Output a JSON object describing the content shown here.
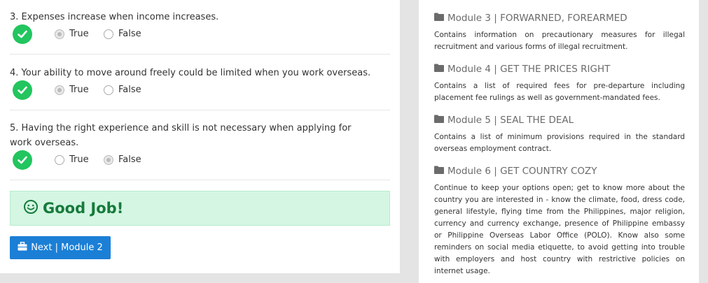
{
  "quiz": {
    "questions": [
      {
        "text": "3. Expenses increase when income increases.",
        "true_label": "True",
        "false_label": "False",
        "selected": "True"
      },
      {
        "text": "4. Your ability to move around freely could be limited when you work overseas.",
        "true_label": "True",
        "false_label": "False",
        "selected": "True"
      },
      {
        "text": "5. Having the right experience and skill is not necessary when applying for work overseas.",
        "true_label": "True",
        "false_label": "False",
        "selected": "False"
      }
    ],
    "result_message": "Good Job!",
    "next_button": "Next | Module 2"
  },
  "modules": [
    {
      "title": "Module 3 | FORWARNED, FOREARMED",
      "description": "Contains information on precautionary measures for illegal recruitment and various forms of illegal recruitment."
    },
    {
      "title": "Module 4 | GET THE PRICES RIGHT",
      "description": "Contains a list of required fees for pre-departure including placement fee rulings as well as government-mandated fees."
    },
    {
      "title": "Module 5 | SEAL THE DEAL",
      "description": "Contains a list of minimum provisions required in the standard overseas employment contract."
    },
    {
      "title": "Module 6 | GET COUNTRY COZY",
      "description": "Continue to keep your options open; get to know more about the country you are interested in - know the climate, food, dress code, general lifestyle, flying time from the Philippines, major religion, currency and currency exchange, presence of Philippine embassy or Philippine Overseas Labor Office (POLO). Know also some reminders on social media etiquette, to avoid getting into trouble with employers and host country with restrictive policies on internet usage."
    }
  ],
  "colors": {
    "success": "#22c55e",
    "alert_bg": "#d4f6e3",
    "alert_text": "#167a3b",
    "button": "#1b7fd6"
  },
  "icons": {
    "check": "check-circle-icon",
    "smile": "smile-icon",
    "next": "briefcase-icon",
    "module": "folder-icon"
  }
}
